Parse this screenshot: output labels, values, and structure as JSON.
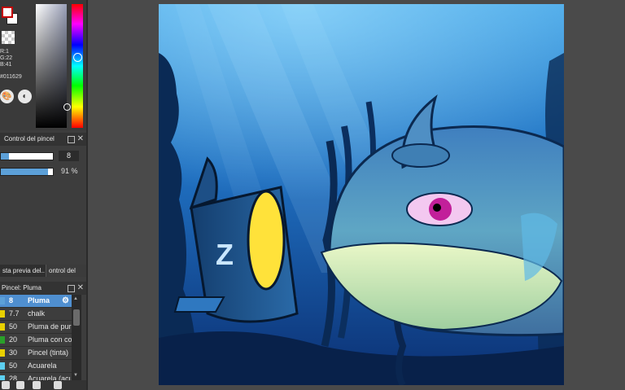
{
  "color_panel": {
    "rgb_r": "R:1",
    "rgb_g": "G:22",
    "rgb_b": "B:41",
    "hex": "#011629",
    "main_color": "#ffffff",
    "accent": "#c40000"
  },
  "brush_control": {
    "title": "Control del pincel",
    "size_value": "8",
    "opacity_value": "91 %",
    "size_fraction": 0.15,
    "opacity_fraction": 0.91
  },
  "tabs": {
    "preview": "sta previa del..",
    "control": "ontrol del"
  },
  "brush_panel": {
    "title": "Pincel: Pluma",
    "items": [
      {
        "size": "8",
        "name": "Pluma",
        "color": "#5ca0d8"
      },
      {
        "size": "7.7",
        "name": "chalk",
        "color": "#e8d000"
      },
      {
        "size": "50",
        "name": "Pluma de pur",
        "color": "#e8d000"
      },
      {
        "size": "20",
        "name": "Pluma con co",
        "color": "#2aa02a"
      },
      {
        "size": "30",
        "name": "Pincel (tinta)",
        "color": "#e8d000"
      },
      {
        "size": "50",
        "name": "Acuarela",
        "color": "#5ccff0"
      },
      {
        "size": "28",
        "name": "Acuarela (acu",
        "color": "#5ccff0"
      }
    ]
  }
}
